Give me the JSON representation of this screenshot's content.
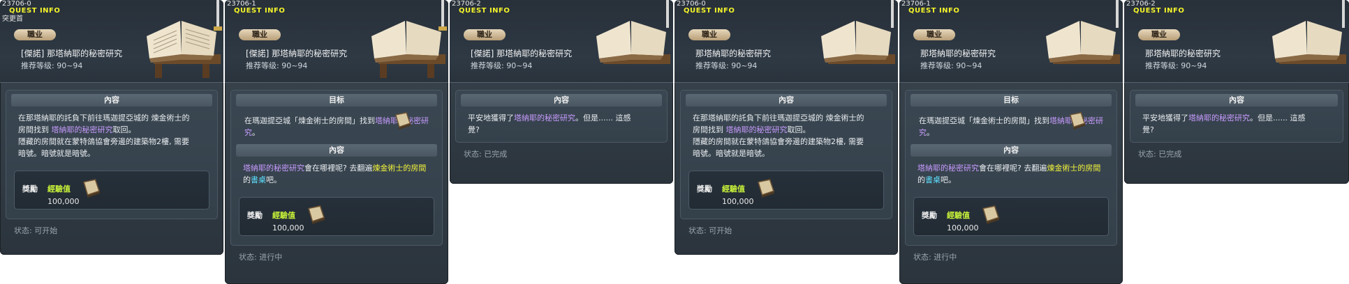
{
  "panels": [
    {
      "id": "23706-0",
      "header_title": "QUEST INFO",
      "sub": "突更首",
      "job": "職业",
      "quest_title": "[傑諾] 那塔納耶的秘密研究",
      "level": "推荐等级: 90~94",
      "sections": {
        "goal": null,
        "content_title": "內容",
        "content_lines": [
          {
            "t": "在那塔納耶的託負下前往瑪迦提亞城的 煉金術士的"
          },
          {
            "t": "房間找到 ",
            "hl": "塔納耶的秘密研究",
            "hl_color": "purple",
            "after": "取回。"
          },
          {
            "t": "隱藏的房間就在蒙特鴿協會旁邊的建築物2樓, 需要"
          },
          {
            "t": "暗號。暗號就是暗號。"
          }
        ]
      },
      "reward": {
        "label": "獎勵",
        "exp_label": "經驗值",
        "exp_value": "100,000"
      },
      "status": "状态: 可开始"
    },
    {
      "id": "23706-1",
      "header_title": "QUEST INFO",
      "sub": "",
      "job": "職业",
      "quest_title": "[傑諾] 那塔納耶的秘密研究",
      "level": "推荐等级: 90~94",
      "goal_title": "目标",
      "goal_text_a": "在瑪迦提亞城「煉金術士的房間」找到",
      "goal_text_hl": "塔納耶的秘密研究",
      "goal_text_b": "。",
      "content_title": "內容",
      "content_hl1": "塔納耶的秘密研究",
      "content_a": "會在哪裡呢? 去翻遍",
      "content_hl2": "煉金術士的房間",
      "content_b": "的",
      "content_hl3": "書桌",
      "content_c": "吧。",
      "reward": {
        "label": "獎勵",
        "exp_label": "經驗值",
        "exp_value": "100,000"
      },
      "status": "状态: 进行中"
    },
    {
      "id": "23706-2",
      "header_title": "QUEST INFO",
      "sub": "",
      "job": "職业",
      "quest_title": "[傑諾] 那塔納耶的秘密研究",
      "level": "推荐等级: 90~94",
      "content_title": "內容",
      "content_a": "平安地獲得了",
      "content_hl": "塔納耶的秘密研究",
      "content_b": "。但是...... 這感",
      "content_c": "覺?",
      "status": "状态: 已完成"
    },
    {
      "id": "23706-0",
      "header_title": "QUEST INFO",
      "sub": "",
      "job": "職业",
      "quest_title": "那塔納耶的秘密研究",
      "level": "推荐等级: 90~94",
      "content_title": "內容",
      "reward": {
        "label": "獎勵",
        "exp_label": "經驗值",
        "exp_value": "100,000"
      },
      "status": "状态: 可开始"
    },
    {
      "id": "23706-1",
      "header_title": "QUEST INFO",
      "sub": "",
      "job": "職业",
      "quest_title": "那塔納耶的秘密研究",
      "level": "推荐等级: 90~94",
      "goal_title": "目标",
      "content_title": "內容",
      "reward": {
        "label": "獎勵",
        "exp_label": "經驗值",
        "exp_value": "100,000"
      },
      "status": "状态: 进行中"
    },
    {
      "id": "23706-2",
      "header_title": "QUEST INFO",
      "sub": "",
      "job": "職业",
      "quest_title": "那塔納耶的秘密研究",
      "level": "推荐等级: 90~94",
      "content_title": "內容",
      "status": "状态: 已完成"
    }
  ],
  "texts": {
    "c0_l1": "在那塔納耶的託負下前往瑪迦提亞城的 煉金術士的",
    "c0_l2a": "房間找到 ",
    "c0_l2hl": "塔納耶的秘密研究",
    "c0_l2b": "取回。",
    "c0_l3": "隱藏的房間就在蒙特鴿協會旁邊的建築物2樓, 需要",
    "c0_l4": "暗號。暗號就是暗號。"
  }
}
